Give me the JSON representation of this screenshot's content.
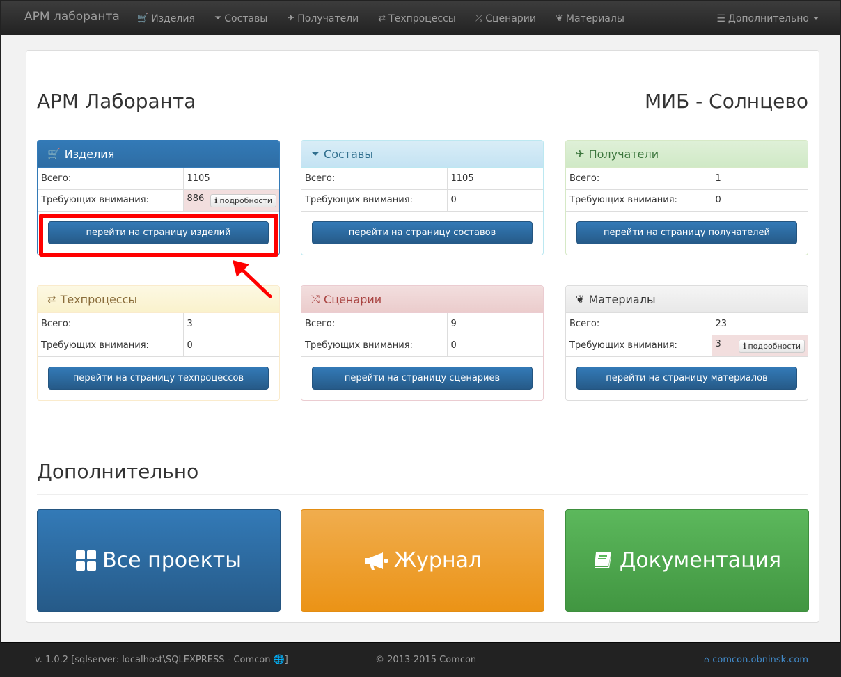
{
  "navbar": {
    "brand": "АРМ лаборанта",
    "items": [
      {
        "label": "Изделия",
        "icon": "shopping-cart-icon",
        "glyph": "🛒"
      },
      {
        "label": "Составы",
        "icon": "filter-icon",
        "glyph": "⏷"
      },
      {
        "label": "Получатели",
        "icon": "plane-icon",
        "glyph": "✈"
      },
      {
        "label": "Техпроцессы",
        "icon": "retweet-icon",
        "glyph": "⇄"
      },
      {
        "label": "Сценарии",
        "icon": "random-icon",
        "glyph": "⤮"
      },
      {
        "label": "Материалы",
        "icon": "leaf-icon",
        "glyph": "❦"
      }
    ],
    "more": {
      "label": "Дополнительно",
      "icon": "list-icon",
      "glyph": "☰"
    }
  },
  "header": {
    "title": "АРМ Лаборанта",
    "location": "МИБ - Солнцево"
  },
  "panels": [
    {
      "title": "Изделия",
      "total_label": "Всего:",
      "total": "1105",
      "attention_label": "Требующих внимания:",
      "attention": "886",
      "details": "подробности",
      "button": "перейти на страницу изделий"
    },
    {
      "title": "Составы",
      "total_label": "Всего:",
      "total": "1105",
      "attention_label": "Требующих внимания:",
      "attention": "0",
      "button": "перейти на страницу составов"
    },
    {
      "title": "Получатели",
      "total_label": "Всего:",
      "total": "1",
      "attention_label": "Требующих внимания:",
      "attention": "0",
      "button": "перейти на страницу получателей"
    },
    {
      "title": "Техпроцессы",
      "total_label": "Всего:",
      "total": "3",
      "attention_label": "Требующих внимания:",
      "attention": "0",
      "button": "перейти на страницу техпроцессов"
    },
    {
      "title": "Сценарии",
      "total_label": "Всего:",
      "total": "9",
      "attention_label": "Требующих внимания:",
      "attention": "0",
      "button": "перейти на страницу сценариев"
    },
    {
      "title": "Материалы",
      "total_label": "Всего:",
      "total": "23",
      "attention_label": "Требующих внимания:",
      "attention": "3",
      "details": "подробности",
      "button": "перейти на страницу материалов"
    }
  ],
  "extra": {
    "title": "Дополнительно",
    "buttons": [
      {
        "label": "Все проекты",
        "icon": "th-large-icon"
      },
      {
        "label": "Журнал",
        "icon": "bullhorn-icon"
      },
      {
        "label": "Документация",
        "icon": "book-icon"
      }
    ]
  },
  "footer": {
    "version": "v. 1.0.2 [sqlserver: localhost\\SQLEXPRESS - Comcon",
    "copyright": "© 2013-2015 Comcon",
    "link": "comcon.obninsk.com"
  },
  "colors": {
    "primary": "#337ab7",
    "warning": "#f0ad4e",
    "success": "#5cb85c",
    "highlight": "#ff0000"
  }
}
